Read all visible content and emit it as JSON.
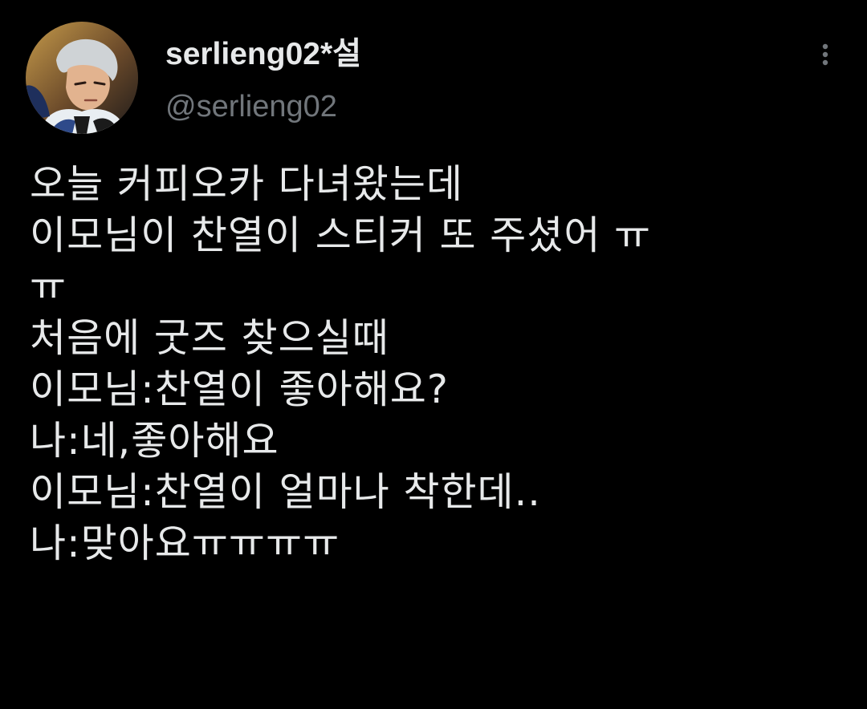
{
  "tweet": {
    "author": {
      "display_name": "serlieng02*설",
      "handle": "@serlieng02"
    },
    "more_icon": "more-vertical-icon",
    "lines": [
      "오늘 커피오카 다녀왔는데",
      "이모님이 찬열이 스티커 또 주셨어 ㅠ",
      "ㅠ",
      "처음에 굿즈 찾으실때",
      "이모님:찬열이 좋아해요?",
      "나:네,좋아해요",
      "이모님:찬열이 얼마나 착한데..",
      "나:맞아요ㅠㅠㅠㅠ"
    ]
  },
  "colors": {
    "background": "#000000",
    "text_primary": "#e7e9ea",
    "text_secondary": "#71767b"
  }
}
